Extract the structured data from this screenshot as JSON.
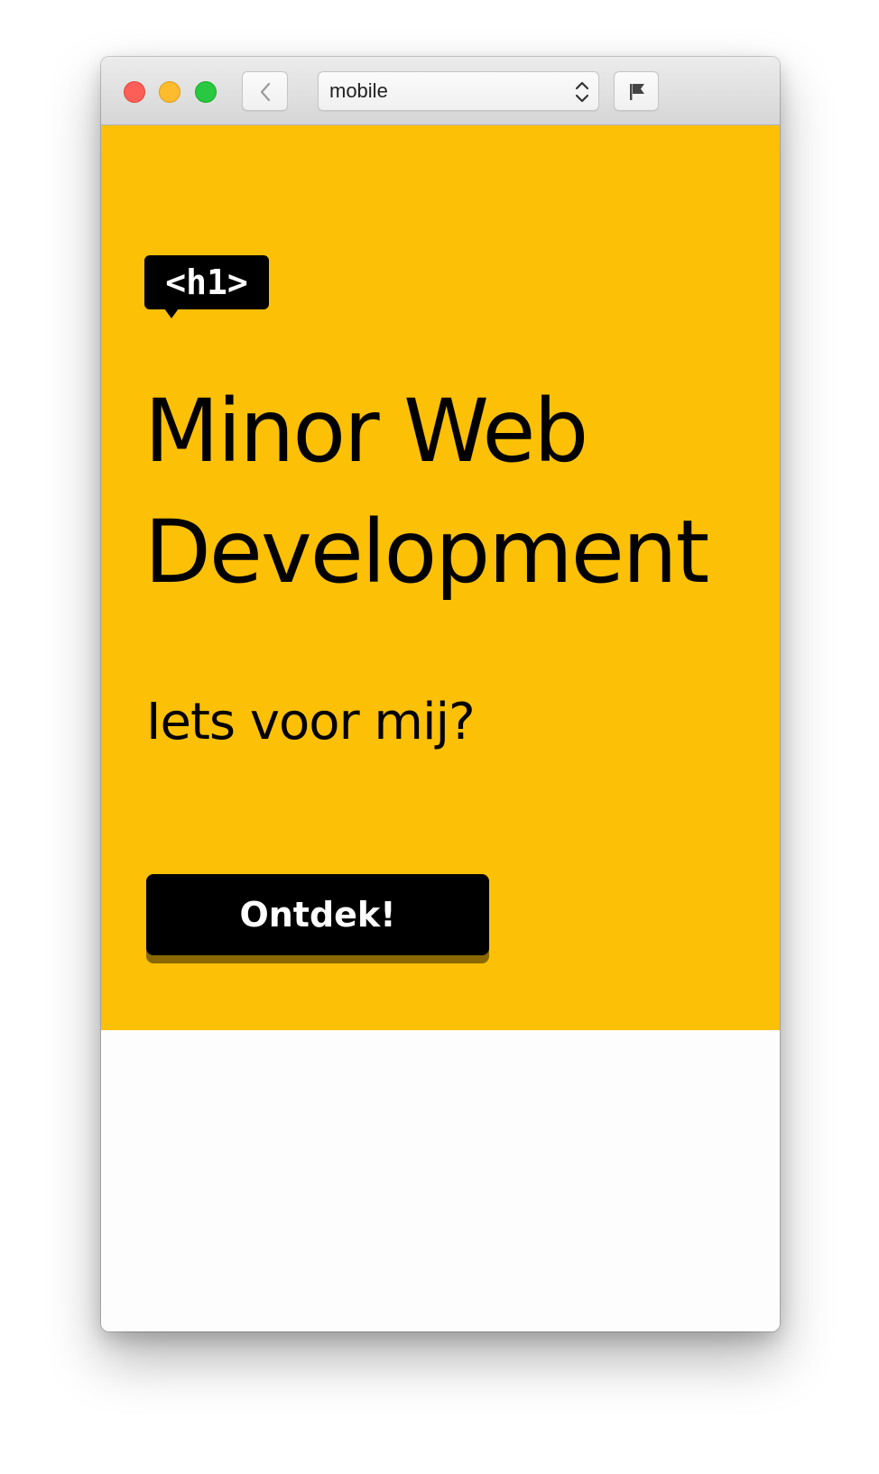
{
  "browser": {
    "viewport_select": {
      "value": "mobile"
    },
    "icons": {
      "back": "chevron-left-icon",
      "select_arrows": "up-down-chevron-icon",
      "flag": "flag-icon"
    }
  },
  "hero": {
    "tag_label": "<h1>",
    "title_line1": "Minor Web",
    "title_line2": "Development",
    "subtitle": "Iets voor mij?",
    "cta_label": "Ontdek!"
  },
  "colors": {
    "hero_background": "#fcc006",
    "button_background": "#000000",
    "button_text": "#ffffff",
    "button_shadow": "#8a6900"
  }
}
